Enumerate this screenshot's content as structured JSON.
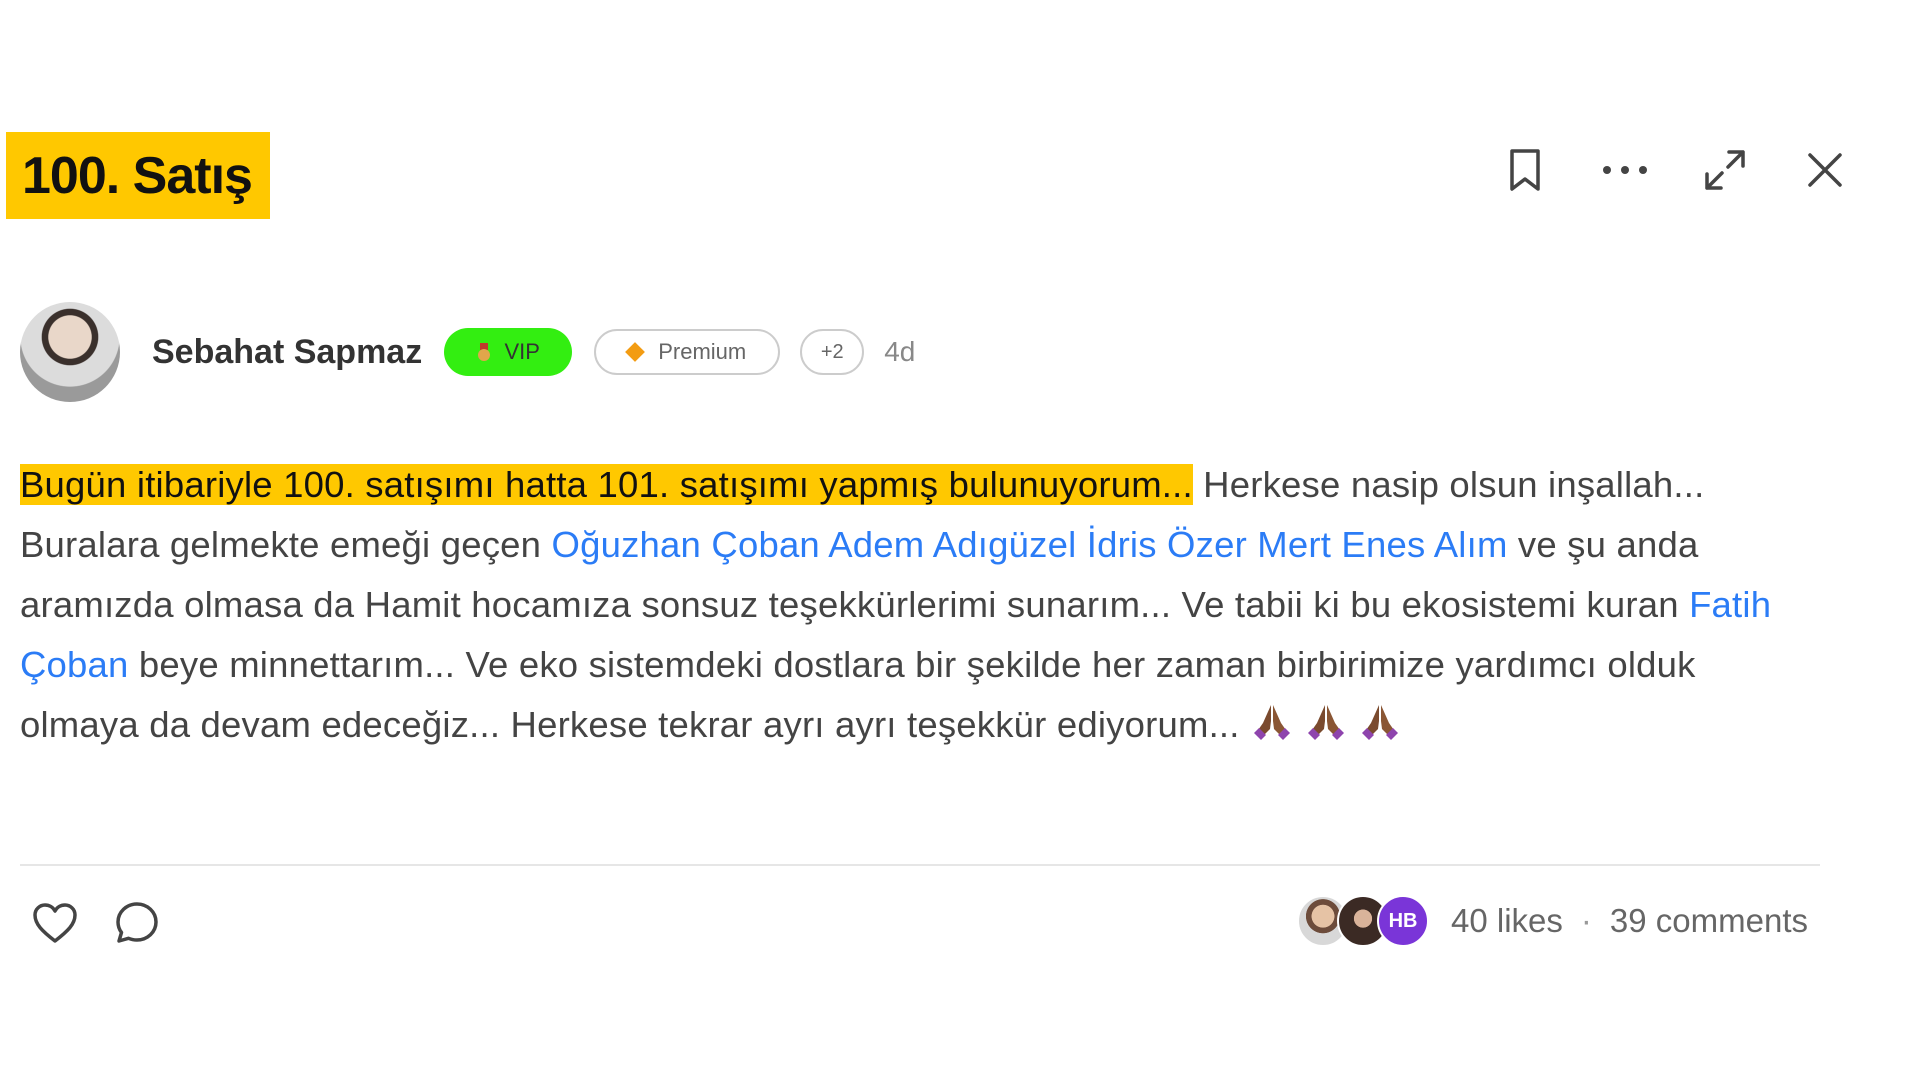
{
  "post": {
    "title": "100. Satış",
    "author": {
      "name": "Sebahat Sapmaz",
      "badges": {
        "vip": "VIP",
        "premium": "Premium",
        "more": "+2"
      },
      "time": "4d"
    },
    "body": {
      "highlighted": "Bugün itibariyle 100. satışımı hatta 101. satışımı yapmış bulunuyorum...",
      "part1": " Herkese nasip olsun inşallah... Buralara gelmekte emeği geçen ",
      "mention1": "Oğuzhan Çoban",
      "mention2": "Adem Adıgüzel",
      "mention3": "İdris Özer",
      "mention4": "Mert Enes Alım",
      "part2": " ve şu anda aramızda olmasa da Hamit hocamıza sonsuz teşekkürlerimi sunarım... Ve tabii ki bu ekosistemi kuran ",
      "mention5": "Fatih Çoban",
      "part3": " beye minnettarım... Ve eko sistemdeki dostlara bir şekilde her zaman birbirimize yardımcı olduk olmaya da devam edeceğiz... Herkese tekrar ayrı ayrı teşekkür ediyorum...",
      "emoji_count": 3
    },
    "stats": {
      "liker_initials": "HB",
      "likes": "40 likes",
      "separator": "·",
      "comments": "39 comments"
    }
  },
  "toolbar": {
    "icons": [
      "bookmark-icon",
      "more-icon",
      "expand-icon",
      "close-icon"
    ]
  },
  "colors": {
    "highlight": "#ffc800",
    "mention": "#2b7cf6",
    "vip_badge": "#33ee11",
    "premium_diamond": "#f39c12",
    "liker_hb": "#7a35d8"
  }
}
